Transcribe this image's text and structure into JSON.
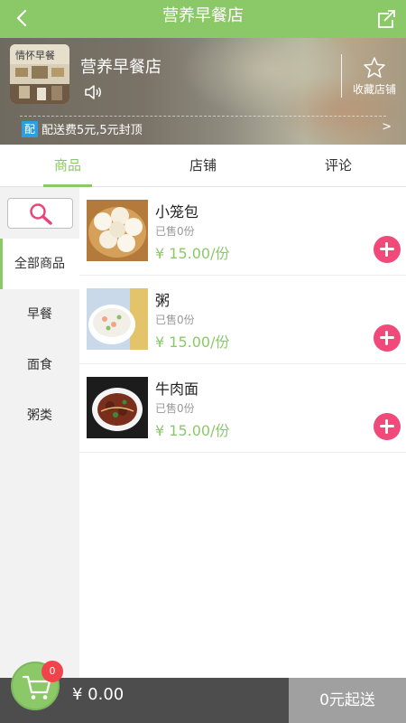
{
  "header": {
    "title": "营养早餐店",
    "back_icon": "back-arrow-icon",
    "share_icon": "share-icon",
    "accent": "#8bc968"
  },
  "store": {
    "name": "营养早餐店",
    "logo_text": "情怀早餐",
    "favorite_label": "收藏店铺",
    "delivery_badge": "配",
    "delivery_notice": "配送费5元,5元封顶",
    "notice_arrow": ">"
  },
  "tabs": [
    {
      "label": "商品",
      "active": true
    },
    {
      "label": "店铺",
      "active": false
    },
    {
      "label": "评论",
      "active": false
    }
  ],
  "sidebar": {
    "search_icon": "search-icon",
    "categories": [
      {
        "label": "全部商品",
        "active": true
      },
      {
        "label": "早餐",
        "active": false
      },
      {
        "label": "面食",
        "active": false
      },
      {
        "label": "粥类",
        "active": false
      }
    ]
  },
  "products": [
    {
      "name": "小笼包",
      "sold": "已售0份",
      "price": "¥ 15.00/份",
      "icon": "steamed-buns-image"
    },
    {
      "name": "粥",
      "sold": "已售0份",
      "price": "¥ 15.00/份",
      "icon": "porridge-image"
    },
    {
      "name": "牛肉面",
      "sold": "已售0份",
      "price": "¥ 15.00/份",
      "icon": "beef-noodles-image"
    }
  ],
  "cart": {
    "count": "0",
    "total": "¥ 0.00",
    "checkout_label": "0元起送",
    "badge_color": "#f0434b",
    "add_color": "#f04a7a"
  }
}
